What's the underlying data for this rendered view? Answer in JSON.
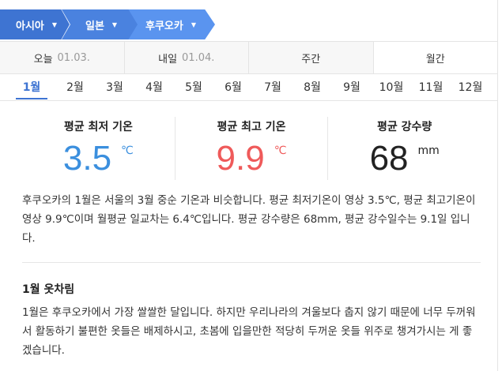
{
  "breadcrumb": [
    {
      "label": "아시아"
    },
    {
      "label": "일본"
    },
    {
      "label": "후쿠오카"
    }
  ],
  "day_tabs": [
    {
      "label": "오늘",
      "date": "01.03."
    },
    {
      "label": "내일",
      "date": "01.04."
    },
    {
      "label": "주간",
      "date": ""
    },
    {
      "label": "월간",
      "date": ""
    }
  ],
  "months": [
    "1월",
    "2월",
    "3월",
    "4월",
    "5월",
    "6월",
    "7월",
    "8월",
    "9월",
    "10월",
    "11월",
    "12월"
  ],
  "selected_month": "1월",
  "stats": {
    "min": {
      "title": "평균 최저 기온",
      "value": "3.5",
      "unit": "℃",
      "color": "#3b8fde"
    },
    "max": {
      "title": "평균 최고 기온",
      "value": "9.9",
      "unit": "℃",
      "color": "#ef5a5a"
    },
    "rain": {
      "title": "평균 강수량",
      "value": "68",
      "unit": "mm",
      "color": "#222222"
    }
  },
  "description": "후쿠오카의 1월은 서울의 3월 중순 기온과 비슷합니다. 평균 최저기온이 영상 3.5℃, 평균 최고기온이 영상 9.9℃이며 월평균 일교차는 6.4℃입니다. 평균 강수량은 68mm, 평균 강수일수는 9.1일 입니다.",
  "clothing": {
    "title": "1월 옷차림",
    "text": "1월은 후쿠오카에서 가장 쌀쌀한 달입니다. 하지만 우리나라의 겨울보다 춥지 않기 때문에 너무 두꺼워서 활동하기 불편한 옷들은 배제하시고, 초봄에 입을만한 적당히 두꺼운 옷들 위주로 챙겨가시는 게 좋겠습니다."
  }
}
